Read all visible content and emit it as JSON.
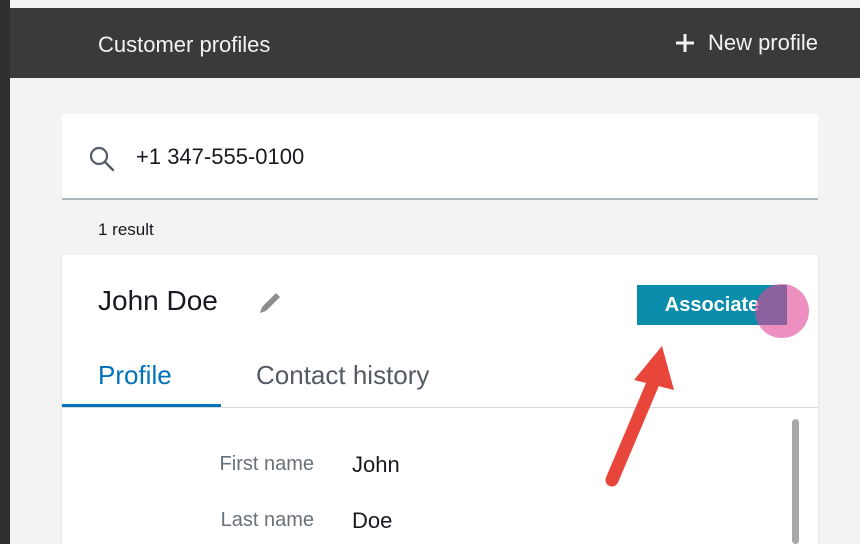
{
  "header": {
    "title": "Customer profiles",
    "new_profile_label": "New profile"
  },
  "search": {
    "value": "+1 347-555-0100"
  },
  "results": {
    "count_label": "1 result"
  },
  "profile": {
    "name": "John Doe",
    "associate_label": "Associate",
    "tabs": [
      {
        "label": "Profile",
        "active": true
      },
      {
        "label": "Contact history",
        "active": false
      }
    ],
    "fields": [
      {
        "label": "First  name",
        "value": "John"
      },
      {
        "label": "Last name",
        "value": "Doe"
      }
    ]
  },
  "icons": {
    "search": "search-icon",
    "plus": "plus-icon",
    "edit": "pencil-icon",
    "annotation": "red-arrow-icon"
  },
  "colors": {
    "header_bg": "#3a3a3a",
    "associate_bg": "#0a8dab",
    "active_tab": "#0073bb",
    "arrow": "#e8463a",
    "click_highlight": "#e14696"
  }
}
